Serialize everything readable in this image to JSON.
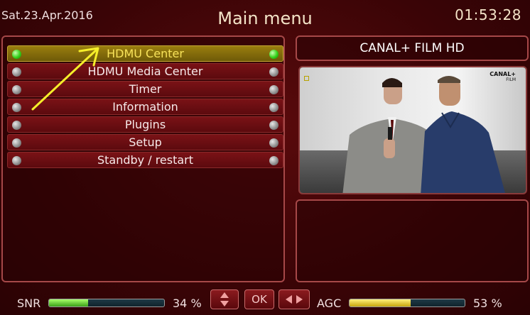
{
  "header": {
    "date": "Sat.23.Apr.2016",
    "title": "Main menu",
    "clock": "01:53:28"
  },
  "menu": {
    "items": [
      {
        "label": "HDMU Center",
        "selected": true
      },
      {
        "label": "HDMU Media Center",
        "selected": false
      },
      {
        "label": "Timer",
        "selected": false
      },
      {
        "label": "Information",
        "selected": false
      },
      {
        "label": "Plugins",
        "selected": false
      },
      {
        "label": "Setup",
        "selected": false
      },
      {
        "label": "Standby / restart",
        "selected": false
      }
    ]
  },
  "channel": {
    "name": "CANAL+ FILM HD",
    "preview_logo": "CANAL+",
    "preview_logo_sub": "FILM"
  },
  "signal": {
    "snr_label": "SNR",
    "snr_value": "34 %",
    "snr_level": 0.34,
    "agc_label": "AGC",
    "agc_value": "53 %",
    "agc_level": 0.53
  },
  "nav": {
    "up_down_icon": "up-down-arrows-icon",
    "ok_label": "OK",
    "left_right_icon": "left-right-arrows-icon"
  },
  "colors": {
    "background": "#3a0406",
    "panel_border": "#a64848",
    "selected_item": "#8a6f0c",
    "selected_text": "#f7e25a",
    "led_active": "#34d21a",
    "arrow": "#f5ee2a"
  }
}
